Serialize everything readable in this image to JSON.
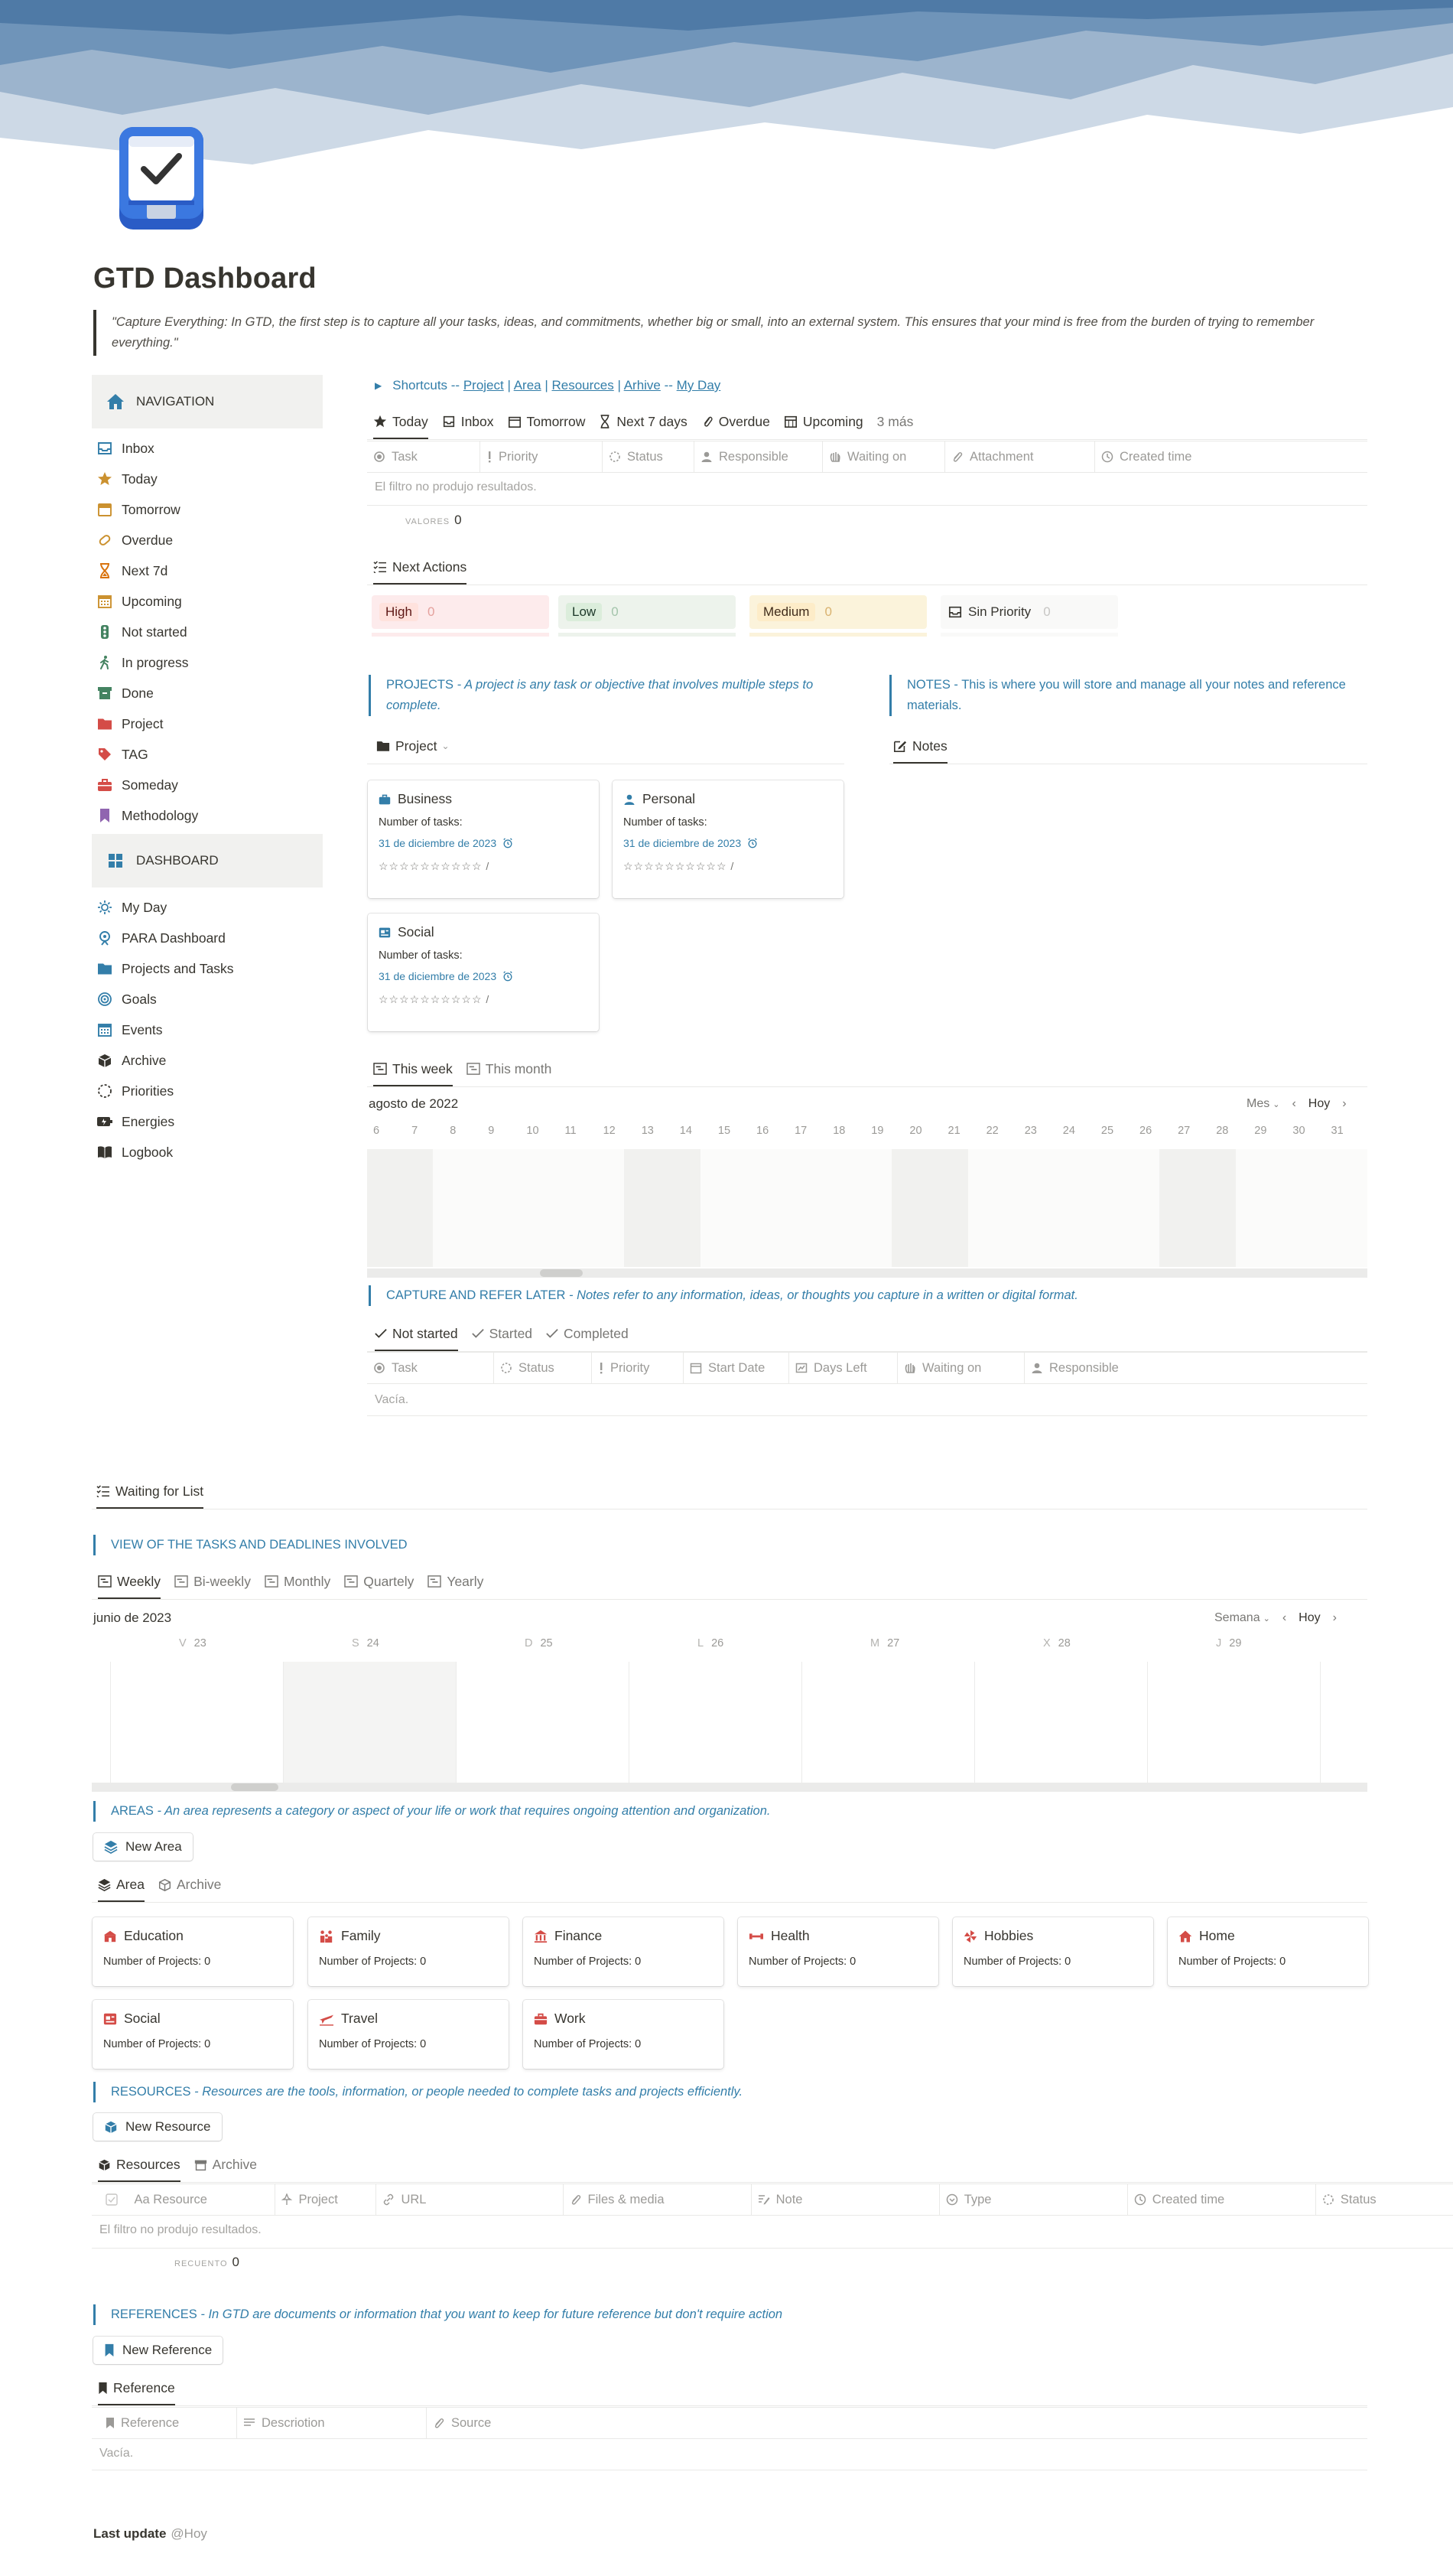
{
  "page": {
    "title": "GTD Dashboard",
    "quote": "\"Capture Everything: In GTD, the first step is to capture all your tasks, ideas, and commitments, whether big or small, into an external system. This ensures that your mind is free from the burden of trying to remember everything.\"",
    "last_update_label": "Last update",
    "last_update_value": "@Hoy"
  },
  "navigation": {
    "header": "NAVIGATION",
    "items": [
      {
        "label": "Inbox",
        "icon": "inbox-icon",
        "color": "#337ea9"
      },
      {
        "label": "Today",
        "icon": "star-icon",
        "color": "#cb912f"
      },
      {
        "label": "Tomorrow",
        "icon": "calendar-icon",
        "color": "#cb912f"
      },
      {
        "label": "Overdue",
        "icon": "paperclip-icon",
        "color": "#cb912f"
      },
      {
        "label": "Next 7d",
        "icon": "hourglass-icon",
        "color": "#d9730d"
      },
      {
        "label": "Upcoming",
        "icon": "calendar-grid-icon",
        "color": "#cb912f"
      },
      {
        "label": "Not started",
        "icon": "traffic-light-icon",
        "color": "#448361"
      },
      {
        "label": "In progress",
        "icon": "walking-icon",
        "color": "#448361"
      },
      {
        "label": "Done",
        "icon": "archive-icon",
        "color": "#448361"
      },
      {
        "label": "Project",
        "icon": "folder-icon",
        "color": "#d44c47"
      },
      {
        "label": "TAG",
        "icon": "tag-icon",
        "color": "#d44c47"
      },
      {
        "label": "Someday",
        "icon": "briefcase-icon",
        "color": "#d44c47"
      },
      {
        "label": "Methodology",
        "icon": "bookmark-icon",
        "color": "#9065b0"
      }
    ]
  },
  "dashboard": {
    "header": "DASHBOARD",
    "items": [
      {
        "label": "My Day",
        "icon": "sun-icon",
        "color": "#337ea9"
      },
      {
        "label": "PARA Dashboard",
        "icon": "compass-icon",
        "color": "#337ea9"
      },
      {
        "label": "Projects and Tasks",
        "icon": "folder-icon",
        "color": "#337ea9"
      },
      {
        "label": "Goals",
        "icon": "target-icon",
        "color": "#337ea9"
      },
      {
        "label": "Events",
        "icon": "calendar-grid-icon",
        "color": "#337ea9"
      },
      {
        "label": "Archive",
        "icon": "archive-box-icon",
        "color": "#37352f"
      },
      {
        "label": "Priorities",
        "icon": "dashed-circle-icon",
        "color": "#37352f"
      },
      {
        "label": "Energies",
        "icon": "battery-icon",
        "color": "#37352f"
      },
      {
        "label": "Logbook",
        "icon": "book-icon",
        "color": "#37352f"
      }
    ]
  },
  "shortcuts": {
    "prefix": "Shortcuts -- ",
    "links": [
      "Project",
      "Area",
      "Resources",
      "Arhive",
      "My Day"
    ],
    "separators": [
      " | ",
      " | ",
      " | ",
      " -- "
    ]
  },
  "tasks_view": {
    "tabs": [
      "Today",
      "Inbox",
      "Tomorrow",
      "Next 7 days",
      "Overdue",
      "Upcoming"
    ],
    "more": "3 más",
    "columns": [
      "Task",
      "Priority",
      "Status",
      "Responsible",
      "Waiting on",
      "Attachment",
      "Created time"
    ],
    "empty": "El filtro no produjo resultados.",
    "calc_label": "VALORES",
    "calc_value": "0"
  },
  "next_actions": {
    "tab": "Next Actions",
    "groups": [
      {
        "label": "High",
        "count": "0",
        "bg": "#fdebec",
        "pill": "#ffe2dd",
        "text": "#5d1715",
        "cnt": "#e4a19d"
      },
      {
        "label": "Low",
        "count": "0",
        "bg": "#edf3ec",
        "pill": "#dbeddb",
        "text": "#1c3829",
        "cnt": "#a3c4ab"
      },
      {
        "label": "Medium",
        "count": "0",
        "bg": "#fbf3db",
        "pill": "#fdecc8",
        "text": "#402c1b",
        "cnt": "#d9b26f"
      },
      {
        "label": "Sin Priority",
        "count": "0",
        "bg": "#f9f9f8",
        "pill": "transparent",
        "text": "#37352f",
        "cnt": "#c7c6c4"
      }
    ]
  },
  "projects": {
    "title": "PROJECTS",
    "desc": " - A project is any task or objective that involves multiple steps to complete.",
    "tab": "Project",
    "cards": [
      {
        "name": "Business",
        "label": "Number of tasks:",
        "date": "31 de diciembre de 2023",
        "stars": "☆☆☆☆☆☆☆☆☆☆ /"
      },
      {
        "name": "Personal",
        "label": "Number of tasks:",
        "date": "31 de diciembre de 2023",
        "stars": "☆☆☆☆☆☆☆☆☆☆ /"
      },
      {
        "name": "Social",
        "label": "Number of tasks:",
        "date": "31 de diciembre de 2023",
        "stars": "☆☆☆☆☆☆☆☆☆☆ /"
      }
    ]
  },
  "notes": {
    "title": "NOTES",
    "desc": " - This is where you will store and manage all your notes and reference materials.",
    "tab": "Notes"
  },
  "timeline1": {
    "tabs": [
      "This week",
      "This month"
    ],
    "month": "agosto de 2022",
    "scale": "Mes",
    "today": "Hoy",
    "days": [
      "6",
      "7",
      "8",
      "9",
      "10",
      "11",
      "12",
      "13",
      "14",
      "15",
      "16",
      "17",
      "18",
      "19",
      "20",
      "21",
      "22",
      "23",
      "24",
      "25",
      "26",
      "27",
      "28",
      "29",
      "30",
      "31"
    ]
  },
  "capture": {
    "title": "CAPTURE AND REFER LATER",
    "desc": " - Notes refer to any information, ideas, or thoughts you capture in a written or digital format.",
    "tabs": [
      "Not started",
      "Started",
      "Completed"
    ],
    "columns": [
      "Task",
      "Status",
      "Priority",
      "Start Date",
      "Days Left",
      "Waiting on",
      "Responsible"
    ],
    "empty": "Vacía."
  },
  "waiting": {
    "tab": "Waiting for List"
  },
  "deadlines": {
    "title": "VIEW OF THE TASKS AND DEADLINES INVOLVED",
    "tabs": [
      "Weekly",
      "Bi-weekly",
      "Monthly",
      "Quartely",
      "Yearly"
    ],
    "month": "junio de 2023",
    "scale": "Semana",
    "today": "Hoy",
    "days": [
      {
        "d": "V",
        "n": "23"
      },
      {
        "d": "S",
        "n": "24"
      },
      {
        "d": "D",
        "n": "25"
      },
      {
        "d": "L",
        "n": "26"
      },
      {
        "d": "M",
        "n": "27"
      },
      {
        "d": "X",
        "n": "28"
      },
      {
        "d": "J",
        "n": "29"
      }
    ]
  },
  "areas": {
    "title": "AREAS",
    "desc": " - An area represents a category or aspect of your life or work that requires ongoing attention and organization.",
    "button": "New Area",
    "tabs": [
      "Area",
      "Archive"
    ],
    "cards": [
      {
        "name": "Education",
        "label": "Number of Projects: 0",
        "icon": "school-icon"
      },
      {
        "name": "Family",
        "label": "Number of Projects: 0",
        "icon": "family-icon"
      },
      {
        "name": "Finance",
        "label": "Number of Projects: 0",
        "icon": "bank-icon"
      },
      {
        "name": "Health",
        "label": "Number of Projects: 0",
        "icon": "dumbbell-icon"
      },
      {
        "name": "Hobbies",
        "label": "Number of Projects: 0",
        "icon": "pinwheel-icon"
      },
      {
        "name": "Home",
        "label": "Number of Projects: 0",
        "icon": "home-icon"
      },
      {
        "name": "Social",
        "label": "Number of Projects: 0",
        "icon": "social-icon"
      },
      {
        "name": "Travel",
        "label": "Number of Projects: 0",
        "icon": "plane-icon"
      },
      {
        "name": "Work",
        "label": "Number of Projects: 0",
        "icon": "work-icon"
      }
    ]
  },
  "resources": {
    "title": "RESOURCES",
    "desc": " - Resources are the tools, information, or people needed to complete tasks and projects efficiently.",
    "button": "New Resource",
    "tabs": [
      "Resources",
      "Archive"
    ],
    "columns": [
      "Aa Resource",
      "Project",
      "URL",
      "Files & media",
      "Note",
      "Type",
      "Created time",
      "Status"
    ],
    "empty": "El filtro no produjo resultados.",
    "calc_label": "RECUENTO",
    "calc_value": "0"
  },
  "references": {
    "title": "REFERENCES",
    "desc": " - In GTD are documents or information that you want to keep for future reference but don't require action",
    "button": "New Reference",
    "tab": "Reference",
    "columns": [
      "Reference",
      "Descriotion",
      "Source"
    ],
    "empty": "Vacía."
  },
  "colors": {
    "accent": "#337ea9",
    "text": "#37352f",
    "muted": "#9b9a97",
    "red": "#d44c47"
  }
}
